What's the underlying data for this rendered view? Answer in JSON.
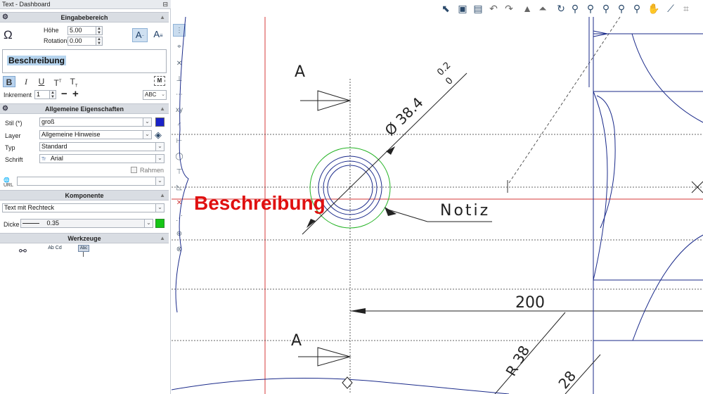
{
  "window": {
    "title": "Text - Dashboard",
    "pin": "⊟"
  },
  "sections": {
    "input": "Eingabebereich",
    "general": "Allgemeine Eigenschaften",
    "component": "Komponente",
    "tools": "Werkzeuge"
  },
  "input": {
    "omega": "Ω",
    "height_label": "Höhe",
    "height_value": "5.00",
    "rotation_label": "Rotation",
    "rotation_value": "0.00",
    "text_value": "Beschreibung",
    "format_buttons": [
      "B",
      "I",
      "U",
      "T",
      "T"
    ],
    "increment_label": "Inkrement",
    "increment_value": "1",
    "minus": "−",
    "plus": "+",
    "abc": "ABC",
    "m_badge": "M"
  },
  "general": {
    "style_label": "Stil (*)",
    "style_value": "groß",
    "style_color": "#1a22c8",
    "layer_label": "Layer",
    "layer_value": "Allgemeine Hinweise",
    "type_label": "Typ",
    "type_value": "Standard",
    "font_label": "Schrift",
    "font_value": "Arial",
    "frame_label": "Rahmen",
    "url_label": "URL",
    "url_value": ""
  },
  "component": {
    "value": "Text mit Rechteck",
    "thickness_label": "Dicke",
    "thickness_value": "0.35",
    "color": "#16c516"
  },
  "tools": {
    "binoculars": "binoculars-icon",
    "abcd": "Ab Cd",
    "abc": "Abc"
  },
  "canvas": {
    "section_label_top": "A",
    "section_label_bottom": "A",
    "diameter_text": "Ø 38.4",
    "tolerance_upper": "0.2",
    "tolerance_lower": "0",
    "note_text": "Notiz",
    "main_text": "Beschreibung",
    "main_text_color": "#e01010",
    "dim_200": "200",
    "radius_text": "R 38",
    "partial_text": "28"
  }
}
